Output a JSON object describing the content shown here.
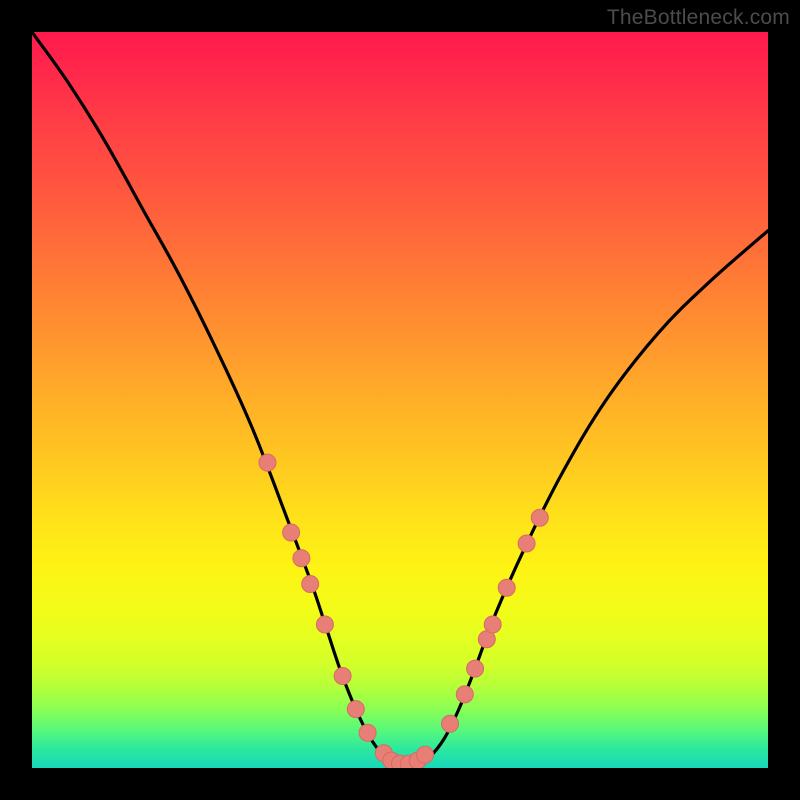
{
  "watermark": "TheBottleneck.com",
  "colors": {
    "background": "#000000",
    "curve": "#000000",
    "dot_fill": "#e77f77",
    "dot_stroke": "#d66b63"
  },
  "chart_data": {
    "type": "line",
    "title": "",
    "xlabel": "",
    "ylabel": "",
    "xlim": [
      0,
      100
    ],
    "ylim": [
      0,
      100
    ],
    "series": [
      {
        "name": "bottleneck-curve",
        "x": [
          0,
          5,
          10,
          15,
          20,
          25,
          30,
          35,
          38,
          40,
          42,
          44,
          46,
          48,
          50,
          52,
          54,
          56,
          58,
          60,
          63,
          67,
          72,
          78,
          85,
          92,
          100
        ],
        "y": [
          100,
          93,
          85,
          76,
          67,
          57,
          46,
          33,
          25,
          19,
          13,
          8,
          4,
          1.5,
          0.5,
          0.5,
          1.5,
          4,
          8,
          13,
          21,
          30,
          40,
          50,
          59,
          66,
          73
        ]
      }
    ],
    "dots": [
      {
        "x": 32.0,
        "y": 41.5
      },
      {
        "x": 35.2,
        "y": 32.0
      },
      {
        "x": 36.6,
        "y": 28.5
      },
      {
        "x": 37.8,
        "y": 25.0
      },
      {
        "x": 39.8,
        "y": 19.5
      },
      {
        "x": 42.2,
        "y": 12.5
      },
      {
        "x": 44.0,
        "y": 8.0
      },
      {
        "x": 45.6,
        "y": 4.8
      },
      {
        "x": 47.8,
        "y": 2.0
      },
      {
        "x": 48.8,
        "y": 1.0
      },
      {
        "x": 50.0,
        "y": 0.6
      },
      {
        "x": 51.2,
        "y": 0.6
      },
      {
        "x": 52.4,
        "y": 1.0
      },
      {
        "x": 53.4,
        "y": 1.8
      },
      {
        "x": 56.8,
        "y": 6.0
      },
      {
        "x": 58.8,
        "y": 10.0
      },
      {
        "x": 60.2,
        "y": 13.5
      },
      {
        "x": 61.8,
        "y": 17.5
      },
      {
        "x": 62.6,
        "y": 19.5
      },
      {
        "x": 64.5,
        "y": 24.5
      },
      {
        "x": 67.2,
        "y": 30.5
      },
      {
        "x": 69.0,
        "y": 34.0
      }
    ]
  }
}
